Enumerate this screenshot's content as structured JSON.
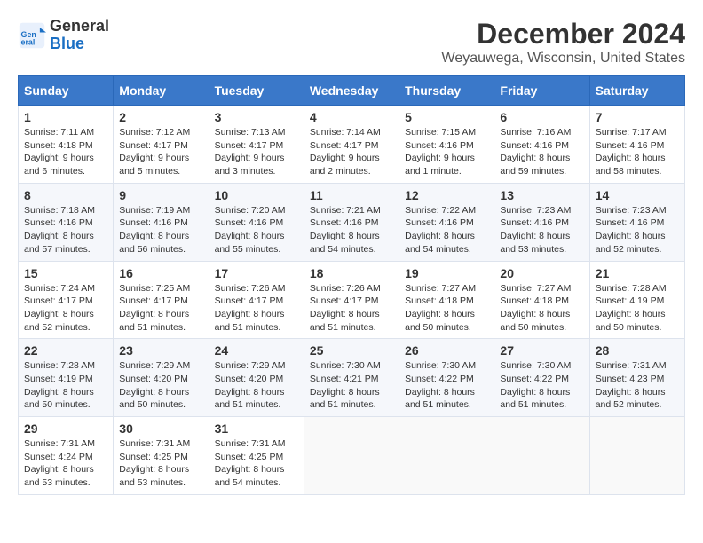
{
  "logo": {
    "general": "General",
    "blue": "Blue"
  },
  "title": "December 2024",
  "location": "Weyauwega, Wisconsin, United States",
  "days_of_week": [
    "Sunday",
    "Monday",
    "Tuesday",
    "Wednesday",
    "Thursday",
    "Friday",
    "Saturday"
  ],
  "weeks": [
    [
      {
        "day": "1",
        "sunrise": "Sunrise: 7:11 AM",
        "sunset": "Sunset: 4:18 PM",
        "daylight": "Daylight: 9 hours and 6 minutes."
      },
      {
        "day": "2",
        "sunrise": "Sunrise: 7:12 AM",
        "sunset": "Sunset: 4:17 PM",
        "daylight": "Daylight: 9 hours and 5 minutes."
      },
      {
        "day": "3",
        "sunrise": "Sunrise: 7:13 AM",
        "sunset": "Sunset: 4:17 PM",
        "daylight": "Daylight: 9 hours and 3 minutes."
      },
      {
        "day": "4",
        "sunrise": "Sunrise: 7:14 AM",
        "sunset": "Sunset: 4:17 PM",
        "daylight": "Daylight: 9 hours and 2 minutes."
      },
      {
        "day": "5",
        "sunrise": "Sunrise: 7:15 AM",
        "sunset": "Sunset: 4:16 PM",
        "daylight": "Daylight: 9 hours and 1 minute."
      },
      {
        "day": "6",
        "sunrise": "Sunrise: 7:16 AM",
        "sunset": "Sunset: 4:16 PM",
        "daylight": "Daylight: 8 hours and 59 minutes."
      },
      {
        "day": "7",
        "sunrise": "Sunrise: 7:17 AM",
        "sunset": "Sunset: 4:16 PM",
        "daylight": "Daylight: 8 hours and 58 minutes."
      }
    ],
    [
      {
        "day": "8",
        "sunrise": "Sunrise: 7:18 AM",
        "sunset": "Sunset: 4:16 PM",
        "daylight": "Daylight: 8 hours and 57 minutes."
      },
      {
        "day": "9",
        "sunrise": "Sunrise: 7:19 AM",
        "sunset": "Sunset: 4:16 PM",
        "daylight": "Daylight: 8 hours and 56 minutes."
      },
      {
        "day": "10",
        "sunrise": "Sunrise: 7:20 AM",
        "sunset": "Sunset: 4:16 PM",
        "daylight": "Daylight: 8 hours and 55 minutes."
      },
      {
        "day": "11",
        "sunrise": "Sunrise: 7:21 AM",
        "sunset": "Sunset: 4:16 PM",
        "daylight": "Daylight: 8 hours and 54 minutes."
      },
      {
        "day": "12",
        "sunrise": "Sunrise: 7:22 AM",
        "sunset": "Sunset: 4:16 PM",
        "daylight": "Daylight: 8 hours and 54 minutes."
      },
      {
        "day": "13",
        "sunrise": "Sunrise: 7:23 AM",
        "sunset": "Sunset: 4:16 PM",
        "daylight": "Daylight: 8 hours and 53 minutes."
      },
      {
        "day": "14",
        "sunrise": "Sunrise: 7:23 AM",
        "sunset": "Sunset: 4:16 PM",
        "daylight": "Daylight: 8 hours and 52 minutes."
      }
    ],
    [
      {
        "day": "15",
        "sunrise": "Sunrise: 7:24 AM",
        "sunset": "Sunset: 4:17 PM",
        "daylight": "Daylight: 8 hours and 52 minutes."
      },
      {
        "day": "16",
        "sunrise": "Sunrise: 7:25 AM",
        "sunset": "Sunset: 4:17 PM",
        "daylight": "Daylight: 8 hours and 51 minutes."
      },
      {
        "day": "17",
        "sunrise": "Sunrise: 7:26 AM",
        "sunset": "Sunset: 4:17 PM",
        "daylight": "Daylight: 8 hours and 51 minutes."
      },
      {
        "day": "18",
        "sunrise": "Sunrise: 7:26 AM",
        "sunset": "Sunset: 4:17 PM",
        "daylight": "Daylight: 8 hours and 51 minutes."
      },
      {
        "day": "19",
        "sunrise": "Sunrise: 7:27 AM",
        "sunset": "Sunset: 4:18 PM",
        "daylight": "Daylight: 8 hours and 50 minutes."
      },
      {
        "day": "20",
        "sunrise": "Sunrise: 7:27 AM",
        "sunset": "Sunset: 4:18 PM",
        "daylight": "Daylight: 8 hours and 50 minutes."
      },
      {
        "day": "21",
        "sunrise": "Sunrise: 7:28 AM",
        "sunset": "Sunset: 4:19 PM",
        "daylight": "Daylight: 8 hours and 50 minutes."
      }
    ],
    [
      {
        "day": "22",
        "sunrise": "Sunrise: 7:28 AM",
        "sunset": "Sunset: 4:19 PM",
        "daylight": "Daylight: 8 hours and 50 minutes."
      },
      {
        "day": "23",
        "sunrise": "Sunrise: 7:29 AM",
        "sunset": "Sunset: 4:20 PM",
        "daylight": "Daylight: 8 hours and 50 minutes."
      },
      {
        "day": "24",
        "sunrise": "Sunrise: 7:29 AM",
        "sunset": "Sunset: 4:20 PM",
        "daylight": "Daylight: 8 hours and 51 minutes."
      },
      {
        "day": "25",
        "sunrise": "Sunrise: 7:30 AM",
        "sunset": "Sunset: 4:21 PM",
        "daylight": "Daylight: 8 hours and 51 minutes."
      },
      {
        "day": "26",
        "sunrise": "Sunrise: 7:30 AM",
        "sunset": "Sunset: 4:22 PM",
        "daylight": "Daylight: 8 hours and 51 minutes."
      },
      {
        "day": "27",
        "sunrise": "Sunrise: 7:30 AM",
        "sunset": "Sunset: 4:22 PM",
        "daylight": "Daylight: 8 hours and 51 minutes."
      },
      {
        "day": "28",
        "sunrise": "Sunrise: 7:31 AM",
        "sunset": "Sunset: 4:23 PM",
        "daylight": "Daylight: 8 hours and 52 minutes."
      }
    ],
    [
      {
        "day": "29",
        "sunrise": "Sunrise: 7:31 AM",
        "sunset": "Sunset: 4:24 PM",
        "daylight": "Daylight: 8 hours and 53 minutes."
      },
      {
        "day": "30",
        "sunrise": "Sunrise: 7:31 AM",
        "sunset": "Sunset: 4:25 PM",
        "daylight": "Daylight: 8 hours and 53 minutes."
      },
      {
        "day": "31",
        "sunrise": "Sunrise: 7:31 AM",
        "sunset": "Sunset: 4:25 PM",
        "daylight": "Daylight: 8 hours and 54 minutes."
      },
      null,
      null,
      null,
      null
    ]
  ]
}
